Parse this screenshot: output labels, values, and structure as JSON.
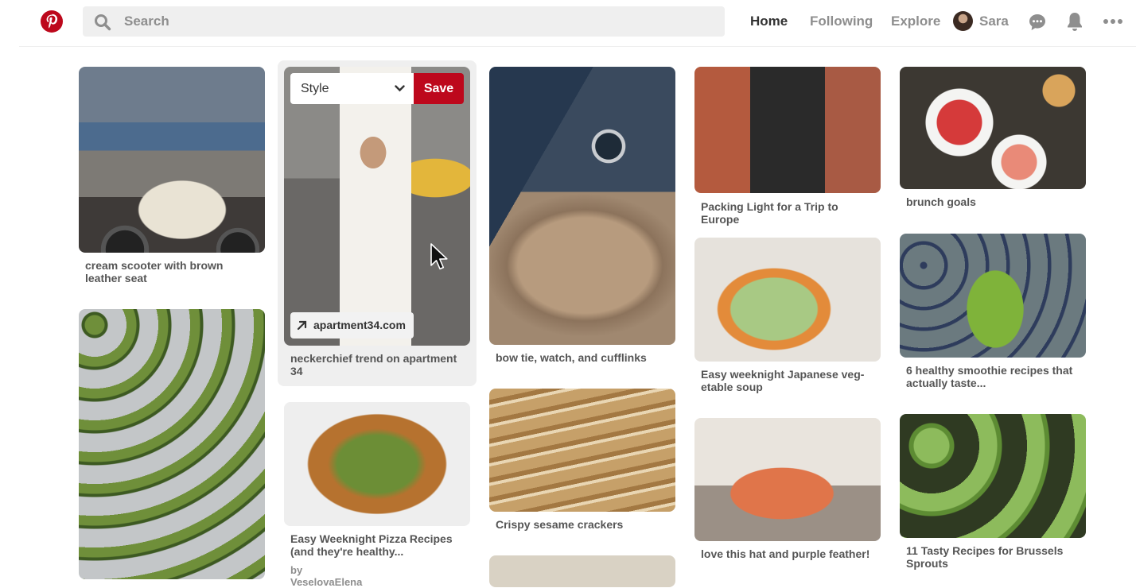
{
  "search": {
    "placeholder": "Search"
  },
  "nav": {
    "home": "Home",
    "following": "Following",
    "explore": "Explore"
  },
  "user": {
    "name": "Sara"
  },
  "icons": {
    "logo": "pinterest-logo-icon",
    "search": "search-icon",
    "messages": "chat-bubble-icon",
    "notifications": "bell-icon",
    "more": "more-dots-icon",
    "board_dropdown": "chevron-down-icon",
    "source_link": "arrow-up-right-icon",
    "cursor": "mouse-pointer-icon"
  },
  "colors": {
    "brand": "#bd081c",
    "text": "#333333",
    "muted": "#8e8e8e"
  },
  "hover_pin": {
    "board_select": "Style",
    "save_label": "Save",
    "source": "apartment34.com"
  },
  "pins": [
    {
      "title": "cream scooter with brown leather seat"
    },
    {
      "title": "neckerchief trend on apartment 34"
    },
    {
      "title": "bow tie, watch, and cufflinks"
    },
    {
      "title": "Packing Light for a Trip to Europe"
    },
    {
      "title": "brunch goals"
    },
    {
      "title": ""
    },
    {
      "title": "Easy Weeknight Pizza Recipes (and they're healthy...",
      "subtitle": "by VeselovaElena"
    },
    {
      "title": "Crispy sesame crackers"
    },
    {
      "title": "Easy weeknight Japanese veg­etable soup"
    },
    {
      "title": "6 healthy smoothie recipes that actually taste..."
    },
    {
      "title": "love this hat and purple feather!"
    },
    {
      "title": "11 Tasty Recipes for Brussels Sprouts"
    }
  ]
}
